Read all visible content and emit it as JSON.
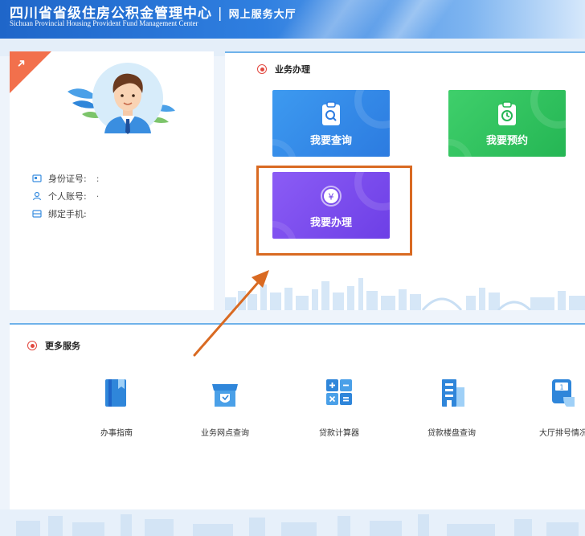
{
  "header": {
    "title": "四川省省级住房公积金管理中心",
    "separator": "|",
    "subtitle": "网上服务大厅",
    "title_en": "Sichuan Provincial Housing Provident Fund Management Center"
  },
  "profile": {
    "fields": [
      {
        "label": "身份证号:",
        "value": ":",
        "icon": "id-card-icon"
      },
      {
        "label": "个人账号:",
        "value": "·",
        "icon": "person-icon"
      },
      {
        "label": "绑定手机:",
        "value": "",
        "icon": "phone-icon"
      }
    ]
  },
  "business": {
    "title": "业务办理",
    "tiles": [
      {
        "label": "我要查询",
        "icon": "search-document-icon",
        "color": "#2c7be0"
      },
      {
        "label": "我要预约",
        "icon": "clock-document-icon",
        "color": "#25b654"
      },
      {
        "label": "我要办理",
        "icon": "yen-coin-icon",
        "color": "#6d3fe6"
      }
    ]
  },
  "more_services": {
    "title": "更多服务",
    "items": [
      {
        "label": "办事指南",
        "icon": "guide-book-icon"
      },
      {
        "label": "业务网点查询",
        "icon": "branch-shop-icon"
      },
      {
        "label": "贷款计算器",
        "icon": "calculator-icon"
      },
      {
        "label": "贷款楼盘查询",
        "icon": "building-icon"
      },
      {
        "label": "大厅排号情况",
        "icon": "queue-ticket-icon"
      }
    ]
  },
  "colors": {
    "accent_red": "#e2483f",
    "highlight_orange": "#d96a22",
    "primary_blue": "#2f7fe0"
  }
}
